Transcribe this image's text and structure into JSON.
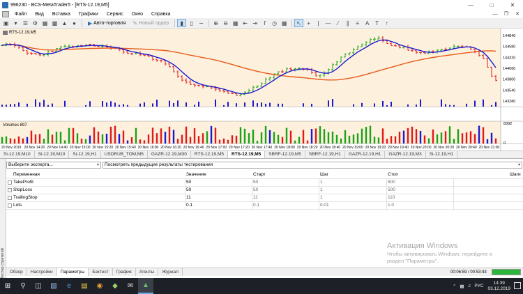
{
  "window": {
    "title": "996230 - BCS-MetaTrader5 - [RTS-12.19,M5]"
  },
  "menu": [
    "Файл",
    "Вид",
    "Вставка",
    "Графики",
    "Сервис",
    "Окно",
    "Справка"
  ],
  "toolbar": {
    "autotrade_label": "Авто-торговля",
    "neworder_label": "Новый ордер"
  },
  "chart": {
    "label": "RTS-12.19,M5",
    "volumes_label": "Volumes 897",
    "volume_axis_top": "8392",
    "volume_axis_zero": "0",
    "price_ticks": [
      {
        "price": 144840,
        "label": "144840"
      },
      {
        "price": 144580,
        "label": "144580"
      },
      {
        "price": 144320,
        "label": "144320"
      },
      {
        "price": 144060,
        "label": "144060"
      },
      {
        "price": 143800,
        "label": "143800"
      },
      {
        "price": 143540,
        "label": "143540"
      },
      {
        "price": 143280,
        "label": "143280"
      }
    ],
    "time_labels": [
      "20 Nov 2019",
      "20 Nov 14:20",
      "20 Nov 14:40",
      "20 Nov 15:00",
      "20 Nov 15:20",
      "20 Nov 15:40",
      "20 Nov 16:00",
      "20 Nov 16:20",
      "20 Nov 16:40",
      "20 Nov 17:00",
      "20 Nov 17:20",
      "20 Nov 17:40",
      "20 Nov 18:00",
      "20 Nov 18:20",
      "20 Nov 18:40",
      "20 Nov 19:00",
      "20 Nov 19:20",
      "20 Nov 19:40",
      "20 Nov 20:00",
      "20 Nov 20:20",
      "20 Nov 20:40",
      "20 Nov 21:00"
    ],
    "colors": {
      "bg": "#fdf0dc",
      "up": "#1aa31a",
      "down": "#e01a1a",
      "fast_ma": "#1a1ad0",
      "slow_ma": "#e85a1a",
      "vol_up": "#1aa31a",
      "vol_down": "#e01a1a",
      "vol_blue": "#1a1ad0"
    }
  },
  "chart_tabs": [
    {
      "label": "Si-12.19,M10",
      "active": false
    },
    {
      "label": "Si-12.19,M10",
      "active": false
    },
    {
      "label": "Si-12.19,H1",
      "active": false
    },
    {
      "label": "USDRUB_TOM,M5",
      "active": false
    },
    {
      "label": "GAZR-12.19,M30",
      "active": false
    },
    {
      "label": "RTS-12.19,M5",
      "active": false
    },
    {
      "label": "RTS-12.19,M5",
      "active": true
    },
    {
      "label": "SBRF-12.19,M5",
      "active": false
    },
    {
      "label": "SBRF-12.19,H1",
      "active": false
    },
    {
      "label": "GAZR-12.19,H1",
      "active": false
    },
    {
      "label": "GAZR-12.19,M3",
      "active": false
    },
    {
      "label": "Si-12.19,H1",
      "active": false
    }
  ],
  "tester": {
    "side_label": "Тестер стратегий",
    "expert_select": "Выберите эксперта...",
    "results_select": "Посмотреть предыдущие результаты тестирования",
    "columns": {
      "name": "Переменная",
      "value": "Значение",
      "start": "Старт",
      "step": "Шаг",
      "stop": "Стоп",
      "steps": "Шаги"
    },
    "rows": [
      {
        "name": "TakeProfit",
        "value": "50",
        "start": "50",
        "step": "1",
        "stop": "500"
      },
      {
        "name": "StopLoss",
        "value": "50",
        "start": "50",
        "step": "1",
        "stop": "500"
      },
      {
        "name": "TrailingStop",
        "value": "11",
        "start": "11",
        "step": "1",
        "stop": "110"
      },
      {
        "name": "Lots",
        "value": "0.1",
        "start": "0.1",
        "step": "0.01",
        "stop": "1.0"
      }
    ],
    "tabs": [
      {
        "label": "Обзор",
        "active": false
      },
      {
        "label": "Настройки",
        "active": false
      },
      {
        "label": "Параметры",
        "active": true
      },
      {
        "label": "Бэктест",
        "active": false
      },
      {
        "label": "График",
        "active": false
      },
      {
        "label": "Агенты",
        "active": false
      },
      {
        "label": "Журнал",
        "active": false
      }
    ],
    "timer": "00:06:59 / 00:53:43",
    "progress": 1.0
  },
  "watermark": {
    "line1": "Активация Windows",
    "line2": "Чтобы активировать Windows, перейдите в",
    "line3": "раздел \"Параметры\"."
  },
  "taskbar": {
    "lang": "РУС",
    "time": "14:39",
    "date": "03.12.2019"
  }
}
